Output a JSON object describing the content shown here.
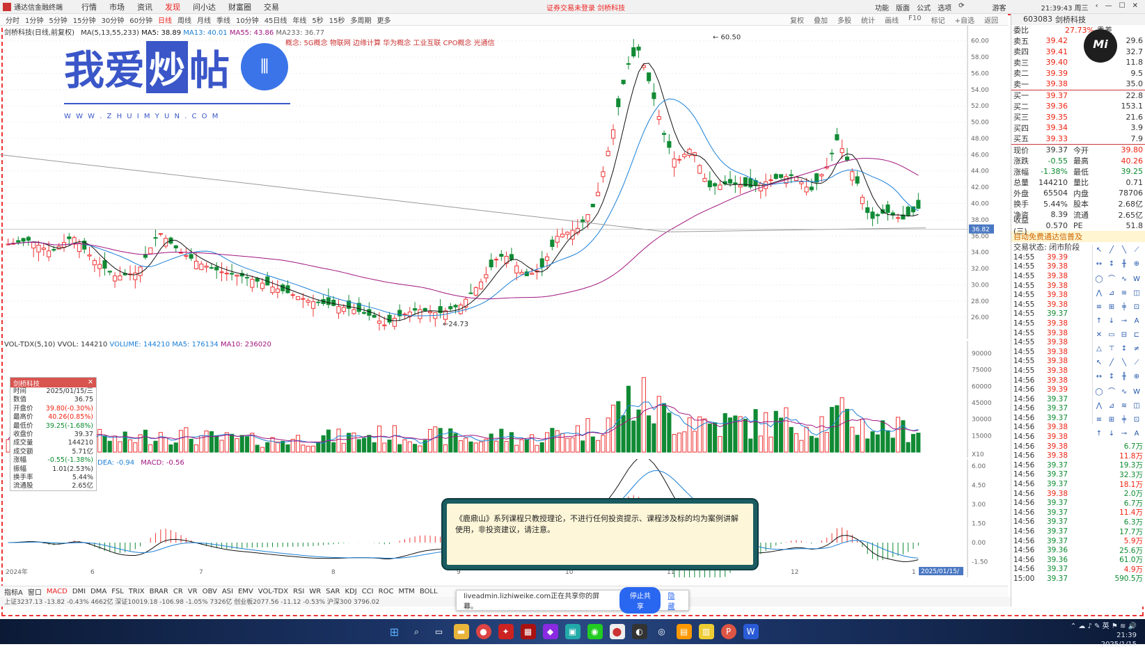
{
  "app": {
    "title": "通达信金融终端",
    "menus": [
      "行情",
      "市场",
      "资讯",
      "发现",
      "问小达",
      "财富圈",
      "交易"
    ],
    "active_menu": "发现",
    "notice": "证券交易未登录 剑桥科技",
    "right_items": [
      "功能",
      "版面",
      "公式",
      "选项"
    ],
    "user": "游客",
    "clock": "21:39:43 周三"
  },
  "period": {
    "items": [
      "分时",
      "1分钟",
      "5分钟",
      "15分钟",
      "30分钟",
      "60分钟",
      "日线",
      "周线",
      "月线",
      "季线",
      "10分钟",
      "45日线",
      "年线",
      "5秒",
      "15秒",
      "多周期",
      "更多"
    ],
    "selected": "日线",
    "tools": [
      "复权",
      "叠加",
      "多股",
      "统计",
      "画线",
      "F10",
      "标记",
      "+自选",
      "返回"
    ]
  },
  "main": {
    "legend_title": "剑桥科技(日线,前复权)",
    "ma_title": "MA(5,13,55,233)",
    "ma5": "MA5: 38.89",
    "ma13": "MA13: 40.01",
    "ma55": "MA55: 43.86",
    "ma233": "MA233: 36.77",
    "concepts": "概念: 5G概念 物联网 边缘计算 华为概念 工业互联 CPO概念 光通信",
    "high_label": "60.50",
    "low_label": "24.73",
    "price_tag": "36.82"
  },
  "logo": {
    "text1": "我爱",
    "text2": "炒",
    "text3": "帖",
    "url": "W W W . Z H U I M Y U N . C O M"
  },
  "volume": {
    "legend": "VOL-TDX(5,10)",
    "vvol": "VVOL: 144210",
    "vol": "VOLUME: 144210",
    "ma5": "MA5: 176134",
    "ma10": "MA10: 236020",
    "scale_note": "X10"
  },
  "macd": {
    "dea": "DEA: -0.94",
    "macd": "MACD: -0.56"
  },
  "info": {
    "name": "剑桥科技",
    "rows": [
      [
        "时间",
        "2025/01/15/三"
      ],
      [
        "数值",
        "36.75"
      ],
      [
        "开盘价",
        "39.80(-0.30%)"
      ],
      [
        "最高价",
        "40.26(0.85%)"
      ],
      [
        "最低价",
        "39.25(-1.68%)"
      ],
      [
        "收盘价",
        "39.37"
      ],
      [
        "成交量",
        "144210"
      ],
      [
        "成交额",
        "5.71亿"
      ],
      [
        "涨幅",
        "-0.55(-1.38%)"
      ],
      [
        "振幅",
        "1.01(2.53%)"
      ],
      [
        "换手率",
        "5.44%"
      ],
      [
        "流通股",
        "2.65亿"
      ]
    ]
  },
  "x_axis": [
    "2024年",
    "6",
    "7",
    "8",
    "9",
    "10",
    "11",
    "12",
    "1"
  ],
  "x_end": "2025/01/15/",
  "indicator_tabs": [
    "指标A",
    "窗口",
    "MACD",
    "DMI",
    "DMA",
    "FSL",
    "TRIX",
    "BRAR",
    "CR",
    "VR",
    "OBV",
    "ASI",
    "EMV",
    "VOL-TDX",
    "RSI",
    "WR",
    "SAR",
    "KDJ",
    "CCI",
    "ROC",
    "MTM",
    "BOLL"
  ],
  "indicator_selected": "MACD",
  "status": "上证3237.13  -13.82  -0.43%  4662亿   深证10019.18  -106.98  -1.05%  7326亿   创业板2077.56  -11.12  -0.53%   沪深300 3796.02",
  "notice_box": "《鹿鼎山》系列课程只教授理论，不进行任何投资提示、课程涉及标的均为案例讲解使用，非投资建议，请注意。",
  "share": {
    "text": "liveadmin.lizhiweike.com正在共享你的屏幕。",
    "stop": "停止共享",
    "hide": "隐藏"
  },
  "quote": {
    "code": "603083",
    "name": "剑桥科技",
    "weibi_label": "委比",
    "weibi": "27.73%",
    "weicha_label": "委差",
    "sell": [
      [
        "卖五",
        "39.42",
        "29.6"
      ],
      [
        "卖四",
        "39.41",
        "32.7"
      ],
      [
        "卖三",
        "39.40",
        "11.8"
      ],
      [
        "卖二",
        "39.39",
        "9.5"
      ],
      [
        "卖一",
        "39.38",
        "35.0"
      ]
    ],
    "buy": [
      [
        "买一",
        "39.37",
        "22.8"
      ],
      [
        "买二",
        "39.36",
        "153.1"
      ],
      [
        "买三",
        "39.35",
        "21.6"
      ],
      [
        "买四",
        "39.34",
        "3.9"
      ],
      [
        "买五",
        "39.33",
        "7.9"
      ]
    ],
    "stats": [
      [
        "现价",
        "39.37",
        "今开",
        "39.80"
      ],
      [
        "涨跌",
        "-0.55",
        "最高",
        "40.26"
      ],
      [
        "涨幅",
        "-1.38%",
        "最低",
        "39.25"
      ],
      [
        "总量",
        "144210",
        "量比",
        "0.71"
      ],
      [
        "外盘",
        "65504",
        "内盘",
        "78706"
      ],
      [
        "换手",
        "5.44%",
        "股本",
        "2.68亿"
      ],
      [
        "净资",
        "8.39",
        "流通",
        "2.65亿"
      ],
      [
        "收益(三)",
        "0.570",
        "PE",
        "51.8"
      ]
    ],
    "auto_label": "自动免费通达信普及",
    "state": "交易状态: 闭市阶段",
    "ticks": [
      [
        "14:55",
        "39.39",
        ""
      ],
      [
        "14:55",
        "39.38",
        ""
      ],
      [
        "14:55",
        "39.38",
        ""
      ],
      [
        "14:55",
        "39.38",
        ""
      ],
      [
        "14:55",
        "39.38",
        ""
      ],
      [
        "14:55",
        "39.38",
        ""
      ],
      [
        "14:55",
        "39.37",
        ""
      ],
      [
        "14:55",
        "39.38",
        ""
      ],
      [
        "14:55",
        "39.38",
        ""
      ],
      [
        "14:55",
        "39.38",
        ""
      ],
      [
        "14:55",
        "39.38",
        ""
      ],
      [
        "14:55",
        "39.38",
        ""
      ],
      [
        "14:55",
        "39.38",
        ""
      ],
      [
        "14:56",
        "39.38",
        ""
      ],
      [
        "14:56",
        "39.39",
        ""
      ],
      [
        "14:56",
        "39.37",
        ""
      ],
      [
        "14:56",
        "39.37",
        ""
      ],
      [
        "14:56",
        "39.37",
        ""
      ],
      [
        "14:56",
        "39.38",
        ""
      ],
      [
        "14:56",
        "39.38",
        ""
      ],
      [
        "14:56",
        "39.38",
        "6.7万"
      ],
      [
        "14:56",
        "39.38",
        "11.8万"
      ],
      [
        "14:56",
        "39.37",
        "19.3万"
      ],
      [
        "14:56",
        "39.37",
        "32.3万"
      ],
      [
        "14:56",
        "39.37",
        "18.1万"
      ],
      [
        "14:56",
        "39.38",
        "2.0万"
      ],
      [
        "14:56",
        "39.37",
        "6.7万"
      ],
      [
        "14:56",
        "39.37",
        "11.4万"
      ],
      [
        "14:56",
        "39.37",
        "6.3万"
      ],
      [
        "14:56",
        "39.37",
        "17.7万"
      ],
      [
        "14:56",
        "39.37",
        "5.9万"
      ],
      [
        "14:56",
        "39.36",
        "25.6万"
      ],
      [
        "14:56",
        "39.36",
        "61.0万"
      ],
      [
        "14:56",
        "39.37",
        "4.9万"
      ],
      [
        "15:00",
        "39.37",
        "590.5万"
      ]
    ]
  },
  "y_axis": [
    "60.00",
    "58.00",
    "56.00",
    "54.00",
    "52.00",
    "50.00",
    "48.00",
    "46.00",
    "44.00",
    "42.00",
    "40.00",
    "38.00",
    "36.00",
    "34.00",
    "32.00",
    "30.00",
    "28.00",
    "26.00"
  ],
  "vol_axis": [
    "90000",
    "75000",
    "60000",
    "45000",
    "30000",
    "15000"
  ],
  "macd_axis": [
    "6.00",
    "4.50",
    "3.00",
    "1.50",
    "0.00",
    "-1.50"
  ],
  "taskbar_time": "21:39",
  "taskbar_date": "2025/1/15"
}
